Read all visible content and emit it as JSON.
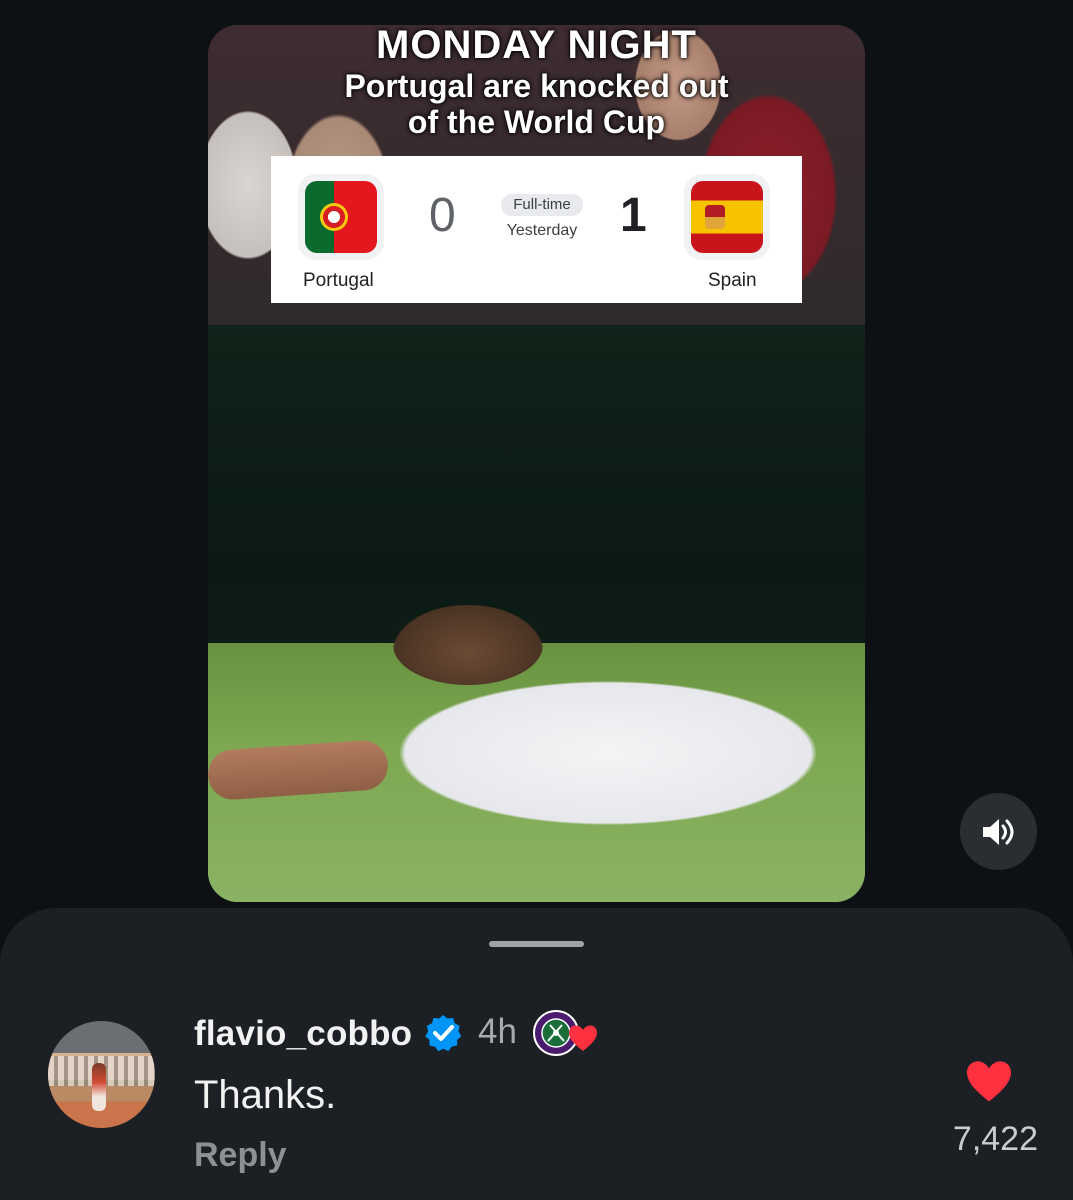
{
  "video": {
    "headline_line1": "MONDAY NIGHT",
    "headline_line2": "Portugal are knocked out",
    "headline_line3": "of the World Cup",
    "scoreboard": {
      "home_team": "Portugal",
      "away_team": "Spain",
      "home_score": "0",
      "away_score": "1",
      "status": "Full-time",
      "date": "Yesterday"
    },
    "sound_icon": "speaker-on-icon"
  },
  "comment": {
    "username": "flavio_cobbo",
    "verified_icon": "verified-badge-icon",
    "time": "4h",
    "badge_icon": "wimbledon-logo-icon",
    "liked_by_creator_icon": "heart-icon",
    "text": "Thanks.",
    "reply_label": "Reply",
    "like_icon": "heart-icon",
    "like_count": "7,422"
  },
  "colors": {
    "background": "#0e1114",
    "sheet": "#1c1f23",
    "like_red": "#ff3040",
    "verified_blue": "#0095f6"
  }
}
